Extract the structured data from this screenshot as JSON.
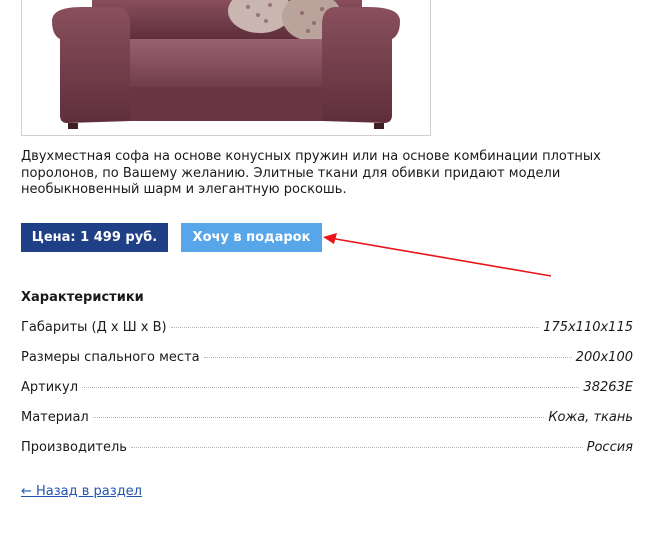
{
  "product": {
    "description": "Двухместная софа на основе конусных пружин или на основе комбинации плотных поролонов, по Вашему желанию. Элитные ткани для обивки придают модели необыкновенный шарм и элегантную роскошь.",
    "price_label": "Цена: 1 499 руб.",
    "gift_button_label": "Хочу в подарок"
  },
  "specs": {
    "heading": "Характеристики",
    "rows": [
      {
        "label": "Габариты (Д х Ш х В)",
        "value": "175x110x115"
      },
      {
        "label": "Размеры спального места",
        "value": "200x100"
      },
      {
        "label": "Артикул",
        "value": "38263E"
      },
      {
        "label": "Материал",
        "value": "Кожа, ткань"
      },
      {
        "label": "Производитель",
        "value": "Россия"
      }
    ]
  },
  "nav": {
    "back_link": "← Назад в раздел"
  },
  "colors": {
    "price_bg": "#1f3f86",
    "button_bg": "#58a6ea",
    "annotation_arrow": "#e8151b",
    "link": "#2255b0"
  }
}
